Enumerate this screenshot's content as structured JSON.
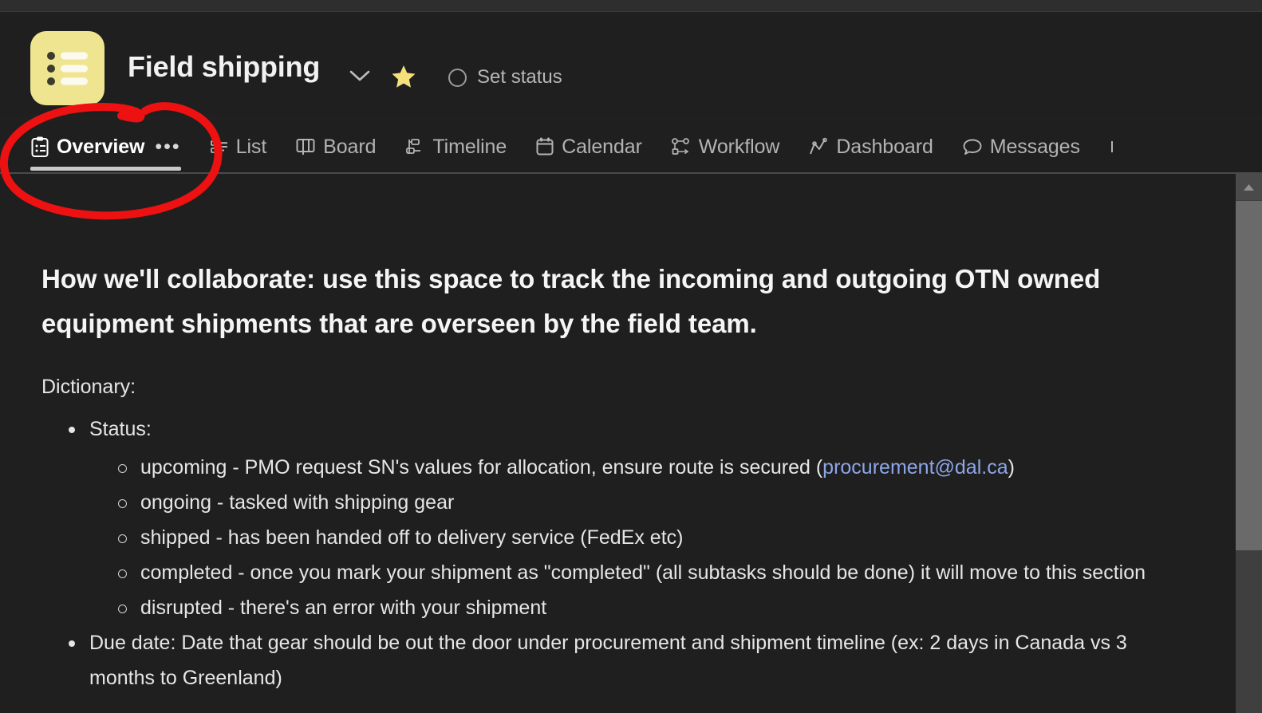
{
  "window": {
    "background_color": "#1f1f1f",
    "top_strip_color": "#2e2e2e"
  },
  "header": {
    "project_icon_name": "list-icon",
    "project_icon_color": "#efe590",
    "title": "Field shipping",
    "chevron_icon": "chevron-down-icon",
    "favorite_icon": "star-icon",
    "favorite_color": "#f5e07a",
    "status": {
      "icon": "circle-outline-icon",
      "label": "Set status"
    }
  },
  "tabs": [
    {
      "label": "Overview",
      "icon": "clipboard-list-icon",
      "active": true,
      "has_overflow_menu": true,
      "overflow_label": "•••"
    },
    {
      "label": "List",
      "icon": "list-icon",
      "active": false
    },
    {
      "label": "Board",
      "icon": "board-icon",
      "active": false
    },
    {
      "label": "Timeline",
      "icon": "timeline-icon",
      "active": false
    },
    {
      "label": "Calendar",
      "icon": "calendar-icon",
      "active": false
    },
    {
      "label": "Workflow",
      "icon": "workflow-icon",
      "active": false
    },
    {
      "label": "Dashboard",
      "icon": "chart-line-icon",
      "active": false
    },
    {
      "label": "Messages",
      "icon": "message-bubble-icon",
      "active": false
    }
  ],
  "content": {
    "heading": "How we'll collaborate: use this space to track the incoming and outgoing OTN owned equipment shipments that are overseen by the field team.",
    "intro": "Dictionary:",
    "bullets": [
      {
        "text": "Status:",
        "children": [
          {
            "text_before": "upcoming - PMO request SN's values for allocation, ensure route is secured (",
            "link": "procurement@dal.ca",
            "link_color": "#8ea6e8",
            "text_after": ")"
          },
          {
            "text_before": "ongoing - tasked with shipping gear",
            "link": "",
            "text_after": ""
          },
          {
            "text_before": "shipped - has been handed off to delivery service (FedEx etc)",
            "link": "",
            "text_after": ""
          },
          {
            "text_before": "completed - once you mark your shipment as \"completed\" (all subtasks should be done) it will move to this section",
            "link": "",
            "text_after": ""
          },
          {
            "text_before": "disrupted - there's an error with your shipment",
            "link": "",
            "text_after": ""
          }
        ]
      },
      {
        "text": "Due date: Date that gear should be out the door under procurement and shipment timeline (ex: 2 days in Canada vs 3 months to Greenland)",
        "children": []
      }
    ]
  },
  "scrollbar": {
    "up_arrow": "scroll-up-arrow-icon",
    "thumb_color": "#6a6a6a",
    "track_color": "#3f3f3f"
  },
  "annotation": {
    "type": "hand-drawn-ellipse",
    "color": "#ee1111",
    "target": "Overview tab"
  }
}
